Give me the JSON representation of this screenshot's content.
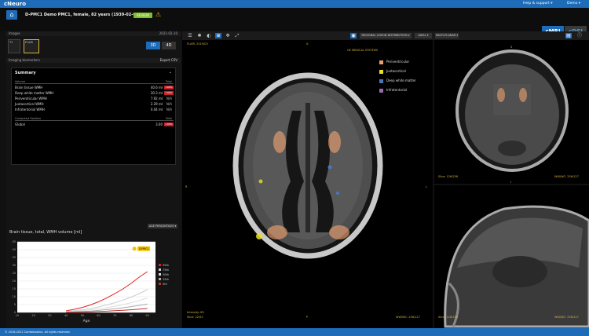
{
  "app": {
    "brand": "cNeuro",
    "help": "Help & support ▾",
    "user": "Demo ▾"
  },
  "patient": {
    "label": "D-PMC1 Demo PMC1, female, 82 years (1939-02-06)",
    "status": "REVIEW",
    "mod_a": "cMRI",
    "mod_b": "cDSI"
  },
  "left": {
    "images_header": "Images",
    "images_id": "2021-02-10",
    "thumb1": "T1",
    "thumb2": "FLAIR",
    "btn_3d": "3D",
    "btn_4d": "4D",
    "findings": "Imaging biomarkers",
    "export": "Export CSV"
  },
  "summary": {
    "title": "Summary",
    "col_volume": "Volume",
    "col_total": "Total",
    "rows": [
      {
        "label": "Brain tissue WMH",
        "value": "40.6 ml",
        "badge": ">99%"
      },
      {
        "label": "Deep white matter WMH",
        "value": "30.3 ml",
        "badge": ">99%"
      },
      {
        "label": "Periventricular WMH",
        "value": "7.92 ml",
        "badge": "N/A"
      },
      {
        "label": "Juxtacortical WMH",
        "value": "2.29 ml",
        "badge": "N/A"
      },
      {
        "label": "Infratentorial WMH",
        "value": "0.04 ml",
        "badge": "N/A"
      }
    ],
    "computed": "Computed Fazekas",
    "computed_total": "Total",
    "global_label": "Global",
    "global_value": "3.00",
    "global_badge": ">99%"
  },
  "age_btn": "AGE PERCENTILES ▾",
  "chart_data": {
    "type": "line",
    "title": "Brain tissue, total, WMH volume [ml]",
    "xlabel": "Age",
    "x": [
      40,
      45,
      50,
      55,
      60,
      65,
      70,
      75,
      80,
      85,
      90
    ],
    "xticks": [
      10,
      20,
      30,
      40,
      50,
      60,
      70,
      80,
      90
    ],
    "yticks": [
      0,
      5,
      10,
      15,
      20,
      25,
      30,
      35,
      40,
      45
    ],
    "xlim": [
      10,
      95
    ],
    "ylim": [
      0,
      45
    ],
    "series": [
      {
        "name": "95th",
        "color": "#e02020",
        "values": [
          1,
          2,
          3.2,
          4.8,
          6.8,
          9.2,
          12,
          15,
          18.5,
          22.5,
          26
        ]
      },
      {
        "name": "75th",
        "color": "#cccccc",
        "values": [
          0.6,
          1.1,
          1.7,
          2.5,
          3.5,
          4.8,
          6.2,
          7.9,
          9.8,
          12,
          14.5
        ]
      },
      {
        "name": "50th",
        "color": "#dddddd",
        "values": [
          0.4,
          0.7,
          1.1,
          1.6,
          2.2,
          3,
          3.9,
          5,
          6.2,
          7.6,
          9.2
        ]
      },
      {
        "name": "25th",
        "color": "#aaaaaa",
        "values": [
          0.2,
          0.4,
          0.6,
          0.9,
          1.3,
          1.8,
          2.3,
          3,
          3.7,
          4.5,
          5.4
        ]
      },
      {
        "name": "5th",
        "color": "#c03030",
        "values": [
          0.1,
          0.2,
          0.3,
          0.4,
          0.6,
          0.8,
          1.1,
          1.4,
          1.7,
          2.1,
          2.5
        ]
      }
    ],
    "patient_point": {
      "x": 82,
      "y": 40.6,
      "label": "D-PMC1"
    }
  },
  "viewer": {
    "dd1": "REGIONAL LESION DISTRIBUTION ▾",
    "dd2": "AXIAL ▾",
    "dd3": "MULTI-PLANAR ▾",
    "ov_tl": "FLAIR, 2019/03",
    "ov_tc": "GE MEDICAL SYSTEMS",
    "ov_bl": "Intensity: 85",
    "ov_slice": "Slice: 22/52",
    "ov_br": "WW/WC: 256/127",
    "cor_slice": "Slice: 126/256",
    "cor_wwc": "WW/WC: 256/127",
    "sag_slice": "Slice: 128/256",
    "sag_wwc": "WW/WC: 256/127",
    "o_a": "A",
    "o_p": "P",
    "o_r": "R",
    "o_l": "L",
    "o_s": "S",
    "o_i": "I"
  },
  "legend": [
    {
      "label": "Periventricular",
      "color": "#e8a070"
    },
    {
      "label": "Juxtacortical",
      "color": "#e8e020"
    },
    {
      "label": "Deep white matter",
      "color": "#4878b8"
    },
    {
      "label": "Infratentorial",
      "color": "#9a6ab0"
    }
  ],
  "footer": "© 2016-2021 Combinostics. All rights reserved."
}
